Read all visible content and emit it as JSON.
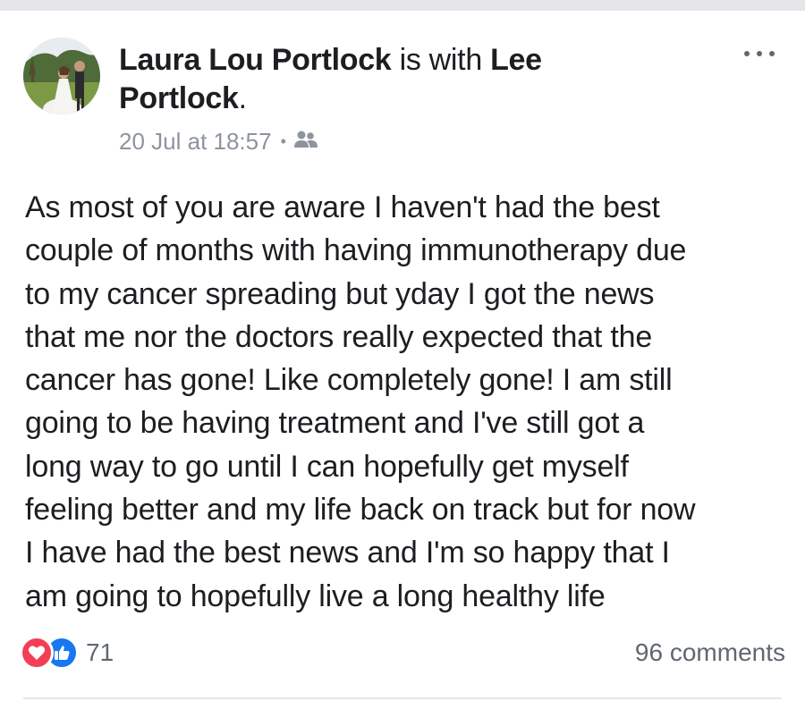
{
  "post": {
    "author": "Laura Lou Portlock",
    "with_text": " is with ",
    "tagged_first": "Lee",
    "tagged_last": "Portlock",
    "period": ".",
    "timestamp": "20 Jul at 18:57",
    "separator": "•",
    "audience_icon": "friends-icon",
    "lines": [
      "As most of you are aware I haven't had the best",
      "couple of months with having immunotherapy due",
      "to my cancer spreading but yday I got the news",
      "that me nor the doctors really expected that the",
      "cancer has gone! Like completely gone! I am still",
      "going to be having treatment and I've still got a",
      "long way to go until I can hopefully get myself",
      "feeling better and my life back on track but for now",
      "I have had the best news and I'm so happy that I",
      "am going to hopefully live a long healthy life"
    ],
    "reaction_count": "71",
    "comments": "96 comments"
  },
  "colors": {
    "love": "#f33e58",
    "like": "#1877f2",
    "meta_text": "#8d949e"
  }
}
